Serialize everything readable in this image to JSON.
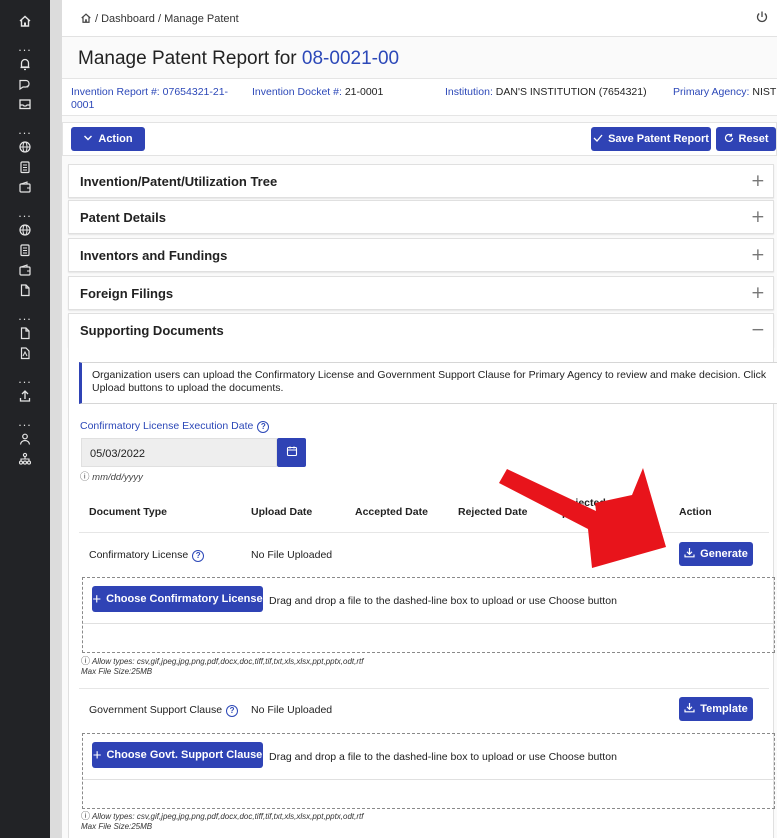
{
  "breadcrumb": {
    "parts": "/ Dashboard / Manage Patent"
  },
  "title": {
    "prefix": "Manage Patent Report for ",
    "patent_id": "08-0021-00"
  },
  "info": {
    "invention_report_label": "Invention Report #:",
    "invention_report_value_1": "07654321-21-",
    "invention_report_value_2": "0001",
    "invention_docket_label": "Invention Docket #:",
    "invention_docket_value": "21-0001",
    "institution_label": "Institution:",
    "institution_value": "DAN'S INSTITUTION (7654321)",
    "primary_agency_label": "Primary Agency:",
    "primary_agency_value": "NIST"
  },
  "toolbar": {
    "action_label": "Action",
    "save_label": "Save Patent Report",
    "reset_label": "Reset"
  },
  "panels": [
    {
      "title": "Invention/Patent/Utilization Tree",
      "state": "+"
    },
    {
      "title": "Patent Details",
      "state": "+"
    },
    {
      "title": "Inventors and Fundings",
      "state": "+"
    },
    {
      "title": "Foreign Filings",
      "state": "+"
    },
    {
      "title": "Supporting Documents",
      "state": "−"
    }
  ],
  "supporting": {
    "note": "Organization users can upload the Confirmatory License and Government Support Clause for Primary Agency to review and make decision. Click Upload buttons to upload the documents.",
    "date_label": "Confirmatory License Execution Date",
    "date_value": "05/03/2022",
    "date_hint": "mm/dd/yyyy",
    "columns": [
      "Document Type",
      "Upload Date",
      "Accepted Date",
      "Rejected Date",
      "Rejected",
      "Reasons",
      "Action"
    ],
    "rows": [
      {
        "doc_type": "Confirmatory License",
        "upload": "No File Uploaded",
        "action_label": "Generate",
        "choose_label": "Choose Confirmatory License",
        "drop_text": "Drag and drop a file to the dashed-line box to upload or use Choose button",
        "allow_types": "Allow types: csv,gif,jpeg,jpg,png,pdf,docx,doc,tiff,tif,txt,xls,xlsx,ppt,pptx,odt,rtf",
        "max_size": "Max File Size:25MB"
      },
      {
        "doc_type": "Government Support Clause",
        "upload": "No File Uploaded",
        "action_label": "Template",
        "choose_label": "Choose Govt. Support Clause",
        "drop_text": "Drag and drop a file to the dashed-line box to upload or use Choose button",
        "allow_types": "Allow types: csv,gif,jpeg,jpg,png,pdf,docx,doc,tiff,tif,txt,xls,xlsx,ppt,pptx,odt,rtf",
        "max_size": "Max File Size:25MB"
      }
    ]
  },
  "sidebar_icons": [
    "home-icon",
    "bell-icon",
    "search-icon",
    "mail-icon",
    "globe-icon",
    "document-icon",
    "wallet-icon",
    "globe-icon",
    "document-icon",
    "wallet-icon",
    "file-icon",
    "file-icon",
    "pdf-icon",
    "upload-icon",
    "user-icon",
    "org-chart-icon"
  ],
  "annotation": {
    "arrow_color": "#e8141b"
  },
  "colors": {
    "primary": "#2f43b5",
    "link": "#2c48b8",
    "sidebar": "#222326"
  }
}
